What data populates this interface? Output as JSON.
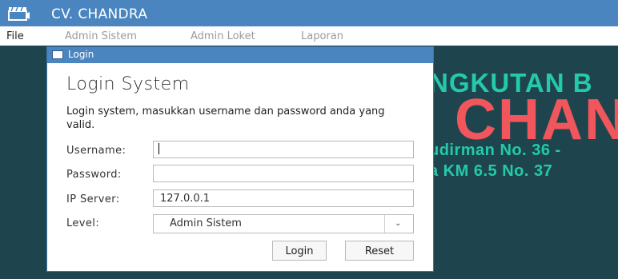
{
  "window": {
    "title": "CV. CHANDRA",
    "icon": "clapperboard-icon"
  },
  "menu": {
    "items": [
      "File",
      "Admin Sistem",
      "Admin Loket",
      "Laporan"
    ]
  },
  "banner": {
    "line1": "NGKUTAN B",
    "line2": "CHAN",
    "line3": "udirman No. 36 -",
    "line4": "a KM 6.5 No. 37",
    "colors": {
      "background": "#1e454e",
      "teal": "#25c9ab",
      "red": "#f0565c"
    }
  },
  "login": {
    "frame_title": "Login",
    "heading": "Login System",
    "description": "Login system, masukkan username dan password anda yang valid.",
    "username_label": "Username:",
    "username_value": "",
    "password_label": "Password:",
    "password_value": "",
    "ip_label": "IP Server:",
    "ip_value": "127.0.0.1",
    "level_label": "Level:",
    "level_value": "Admin Sistem",
    "login_button": "Login",
    "reset_button": "Reset"
  },
  "colors": {
    "titlebar": "#4a85c0"
  }
}
